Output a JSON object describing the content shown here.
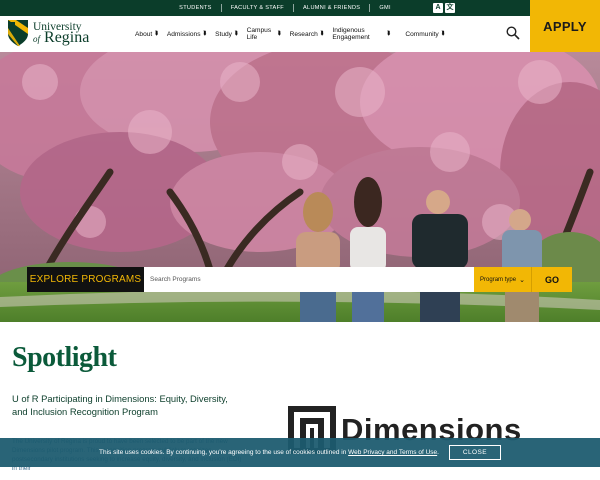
{
  "utility": {
    "links": [
      "STUDENTS",
      "FACULTY & STAFF",
      "ALUMNI & FRIENDS",
      "GMI"
    ],
    "translate_labels": [
      "A",
      "文"
    ]
  },
  "logo": {
    "line1": "University",
    "line2_of": "of",
    "line2": "Regina"
  },
  "nav": {
    "items": [
      {
        "label": "About"
      },
      {
        "label": "Admissions"
      },
      {
        "label": "Study"
      },
      {
        "label": "Campus Life"
      },
      {
        "label": "Research"
      },
      {
        "label": "Indigenous Engagement"
      },
      {
        "label": "Community"
      }
    ],
    "search_icon": "search-icon",
    "apply_label": "APPLY"
  },
  "hero": {
    "explore_label": "EXPLORE PROGRAMS",
    "search_placeholder": "Search Programs",
    "program_type_label": "Program type",
    "go_label": "GO"
  },
  "spotlight": {
    "title": "Spotlight",
    "headline": "U of R Participating in Dimensions: Equity, Diversity, and Inclusion Recognition Program",
    "body": "The University of Regina is proud to have been selected to be part of the new Dimensions pilot program. This recognition program publicly recognizes postsecondary institutions seeking to increase equity, diversity, and inclusion (EDI) in their",
    "dimensions_logo_text": "Dimensions"
  },
  "cookie": {
    "text_before": "This site uses cookies. By continuing, you're agreeing to the use of cookies outlined in ",
    "link_text": "Web Privacy and Terms of Use",
    "text_after": ".",
    "close_label": "CLOSE"
  },
  "colors": {
    "brand_green": "#0b3d2a",
    "accent_gold": "#f2b705",
    "spotlight_green": "#0b5a3a",
    "cookie_bg": "#1c5a6e"
  }
}
